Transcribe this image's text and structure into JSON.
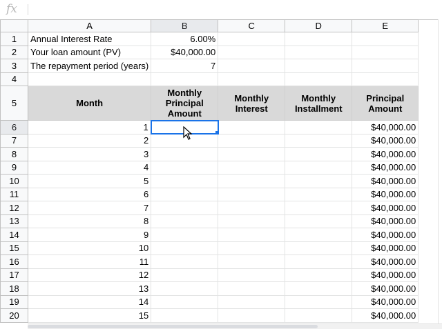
{
  "formula_bar": {
    "icon_label": "fx",
    "value": ""
  },
  "columns": [
    "A",
    "B",
    "C",
    "D",
    "E"
  ],
  "rows_numbers": [
    "1",
    "2",
    "3",
    "4",
    "5",
    "6",
    "7",
    "8",
    "9",
    "10",
    "11",
    "12",
    "13",
    "14",
    "15",
    "16",
    "17",
    "18",
    "19",
    "20"
  ],
  "params": [
    {
      "label": "Annual Interest Rate",
      "value": "6.00%"
    },
    {
      "label": "Your loan amount (PV)",
      "value": "$40,000.00"
    },
    {
      "label": "The repayment period (years)",
      "value": "7"
    }
  ],
  "table_headers": {
    "month": "Month",
    "principal_line1": "Monthly",
    "principal_line2": "Principal",
    "principal_line3": "Amount",
    "interest_line1": "Monthly",
    "interest_line2": "Interest",
    "installment_line1": "Monthly",
    "installment_line2": "Installment",
    "balance_line1": "Principal",
    "balance_line2": "Amount"
  },
  "data_rows": [
    {
      "month": "1",
      "principal_amount": "$40,000.00"
    },
    {
      "month": "2",
      "principal_amount": "$40,000.00"
    },
    {
      "month": "3",
      "principal_amount": "$40,000.00"
    },
    {
      "month": "4",
      "principal_amount": "$40,000.00"
    },
    {
      "month": "5",
      "principal_amount": "$40,000.00"
    },
    {
      "month": "6",
      "principal_amount": "$40,000.00"
    },
    {
      "month": "7",
      "principal_amount": "$40,000.00"
    },
    {
      "month": "8",
      "principal_amount": "$40,000.00"
    },
    {
      "month": "9",
      "principal_amount": "$40,000.00"
    },
    {
      "month": "10",
      "principal_amount": "$40,000.00"
    },
    {
      "month": "11",
      "principal_amount": "$40,000.00"
    },
    {
      "month": "12",
      "principal_amount": "$40,000.00"
    },
    {
      "month": "13",
      "principal_amount": "$40,000.00"
    },
    {
      "month": "14",
      "principal_amount": "$40,000.00"
    },
    {
      "month": "15",
      "principal_amount": "$40,000.00"
    }
  ],
  "selected_cell": "B6",
  "colors": {
    "selection": "#1a73e8",
    "header_fill": "#d9d9d9",
    "gridline": "#e2e3e3"
  }
}
